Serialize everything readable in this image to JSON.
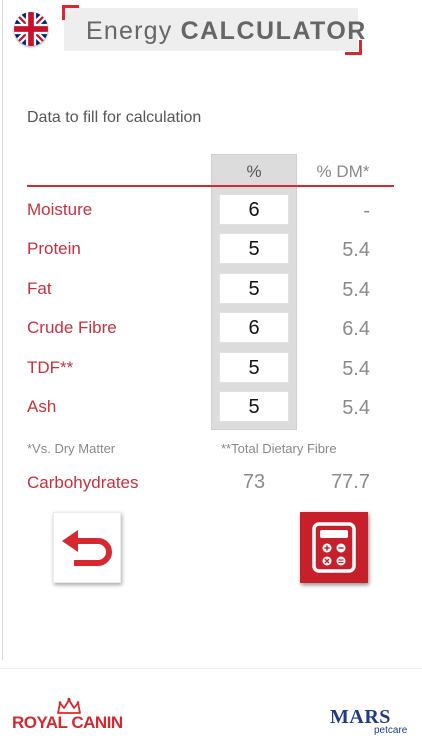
{
  "header": {
    "title_light": "Energy",
    "title_bold": "CALCULATOR",
    "flag_icon": "uk-flag-icon"
  },
  "form": {
    "subtitle": "Data to fill for calculation",
    "col_pct": "%",
    "col_dm": "% DM*",
    "rows": [
      {
        "label": "Moisture",
        "value": "6",
        "dm": "-"
      },
      {
        "label": "Protein",
        "value": "5",
        "dm": "5.4"
      },
      {
        "label": "Fat",
        "value": "5",
        "dm": "5.4"
      },
      {
        "label": "Crude Fibre",
        "value": "6",
        "dm": "6.4"
      },
      {
        "label": "TDF**",
        "value": "5",
        "dm": "5.4"
      },
      {
        "label": "Ash",
        "value": "5",
        "dm": "5.4"
      }
    ],
    "note_left": "*Vs. Dry Matter",
    "note_right": "**Total Dietary Fibre",
    "carbs": {
      "label": "Carbohydrates",
      "pct": "73",
      "dm": "77.7"
    }
  },
  "buttons": {
    "back_icon": "undo-arrow-icon",
    "calc_icon": "calculator-icon"
  },
  "footer": {
    "left_logo_text": "ROYAL CANIN",
    "right_logo_text": "MARS",
    "right_logo_sub": "petcare"
  },
  "colors": {
    "accent_red": "#d7282f",
    "label_red": "#c8303f",
    "mars_blue": "#1f3b84"
  }
}
